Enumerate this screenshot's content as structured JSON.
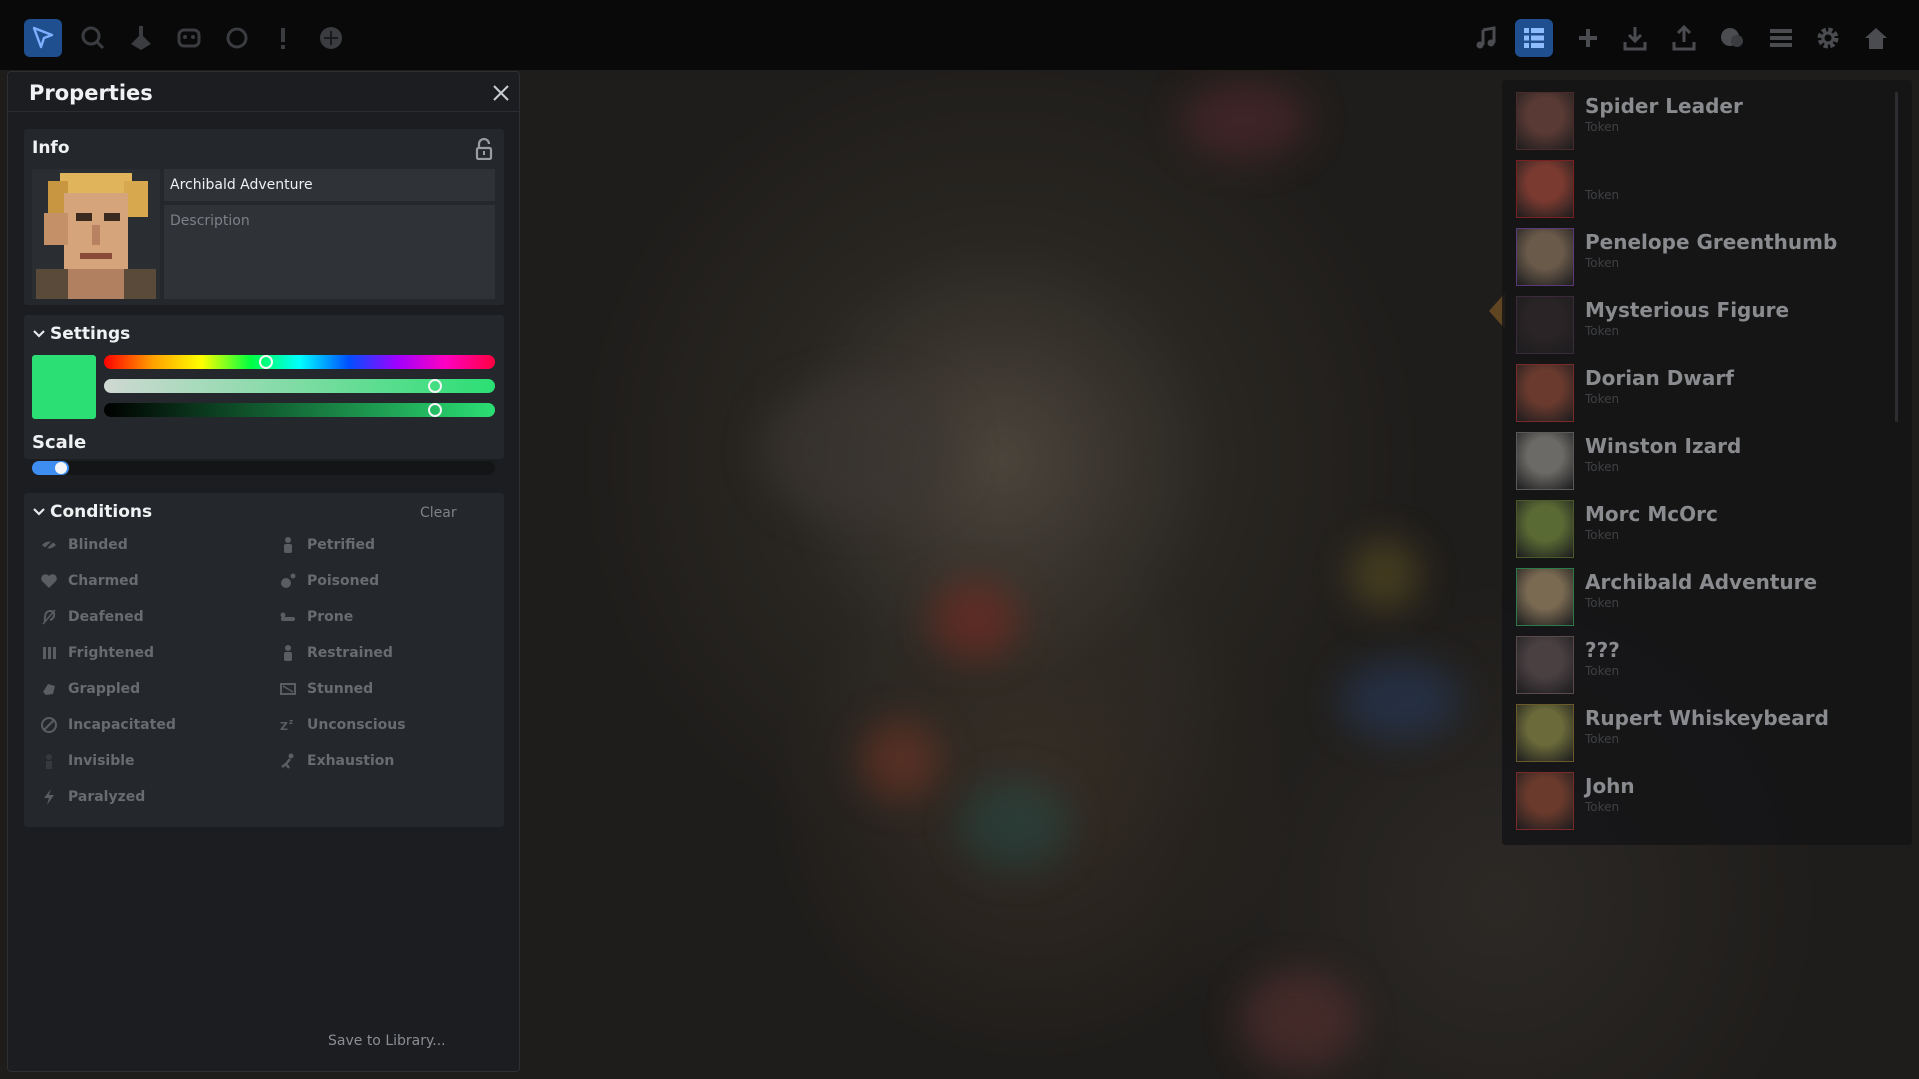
{
  "toolbar": {
    "left_tools": [
      {
        "icon": "cursor-arrow-icon",
        "active": true
      },
      {
        "icon": "search-zoom-icon",
        "active": false
      },
      {
        "icon": "measure-icon",
        "active": false
      },
      {
        "icon": "fog-icon",
        "active": false
      },
      {
        "icon": "circle-shape-icon",
        "active": false
      },
      {
        "icon": "ping-icon",
        "active": false
      },
      {
        "icon": "grid-icon",
        "active": false
      }
    ],
    "right_tools": [
      {
        "icon": "music-note-icon",
        "active": false
      },
      {
        "icon": "list-view-icon",
        "active": true
      },
      {
        "icon": "plus-icon",
        "active": false
      },
      {
        "icon": "download-icon",
        "active": false
      },
      {
        "icon": "upload-icon",
        "active": false
      },
      {
        "icon": "chat-bubbles-icon",
        "active": false
      },
      {
        "icon": "hamburger-menu-icon",
        "active": false
      },
      {
        "icon": "gear-icon",
        "active": false
      },
      {
        "icon": "home-icon",
        "active": false
      }
    ]
  },
  "properties": {
    "title": "Properties",
    "info": {
      "title": "Info",
      "name_value": "Archibald Adventure",
      "description_placeholder": "Description"
    },
    "settings": {
      "title": "Settings",
      "color": "#2bdf74",
      "hue_fraction": 0.41,
      "saturation_fraction": 0.86,
      "lightness_fraction": 0.86,
      "scale_label": "Scale",
      "scale_fraction": 0.05
    },
    "conditions": {
      "title": "Conditions",
      "clear_label": "Clear",
      "left": [
        {
          "label": "Blinded",
          "icon": "blinded-icon"
        },
        {
          "label": "Charmed",
          "icon": "heart-icon"
        },
        {
          "label": "Deafened",
          "icon": "deafened-icon"
        },
        {
          "label": "Frightened",
          "icon": "frightened-icon"
        },
        {
          "label": "Grappled",
          "icon": "grappled-icon"
        },
        {
          "label": "Incapacitated",
          "icon": "incapacitated-icon"
        },
        {
          "label": "Invisible",
          "icon": "invisible-icon"
        },
        {
          "label": "Paralyzed",
          "icon": "lightning-icon"
        }
      ],
      "right": [
        {
          "label": "Petrified",
          "icon": "petrified-icon"
        },
        {
          "label": "Poisoned",
          "icon": "poisoned-icon"
        },
        {
          "label": "Prone",
          "icon": "prone-icon"
        },
        {
          "label": "Restrained",
          "icon": "restrained-icon"
        },
        {
          "label": "Stunned",
          "icon": "stunned-icon"
        },
        {
          "label": "Unconscious",
          "icon": "unconscious-icon"
        },
        {
          "label": "Exhaustion",
          "icon": "exhaustion-icon"
        }
      ]
    },
    "save_label": "Save to Library..."
  },
  "tokens": [
    {
      "name": "Spider Leader",
      "type": "Token",
      "color": "#5a3a34",
      "border": "#4a2a2a"
    },
    {
      "name": "",
      "type": "Token",
      "color": "#7a3a30",
      "border": "#7a2020"
    },
    {
      "name": "Penelope Greenthumb",
      "type": "Token",
      "color": "#6a5a4a",
      "border": "#5a3a7a"
    },
    {
      "name": "Mysterious Figure",
      "type": "Token",
      "color": "#2a2426",
      "border": "#3a2a3a"
    },
    {
      "name": "Dorian Dwarf",
      "type": "Token",
      "color": "#6a3a2e",
      "border": "#7a2a2a"
    },
    {
      "name": "Winston Izard",
      "type": "Token",
      "color": "#6c6a66",
      "border": "#5a5a5a"
    },
    {
      "name": "Morc McOrc",
      "type": "Token",
      "color": "#5a6a34",
      "border": "#4a5a2a"
    },
    {
      "name": "Archibald Adventure",
      "type": "Token",
      "color": "#7a6a52",
      "border": "#2a7a4a"
    },
    {
      "name": "???",
      "type": "Token",
      "color": "#4a4042",
      "border": "#5a4a4a"
    },
    {
      "name": "Rupert Whiskeybeard",
      "type": "Token",
      "color": "#6a6a3a",
      "border": "#6a5a2a"
    },
    {
      "name": "John",
      "type": "Token",
      "color": "#6a3a2c",
      "border": "#7a2a2a"
    }
  ]
}
